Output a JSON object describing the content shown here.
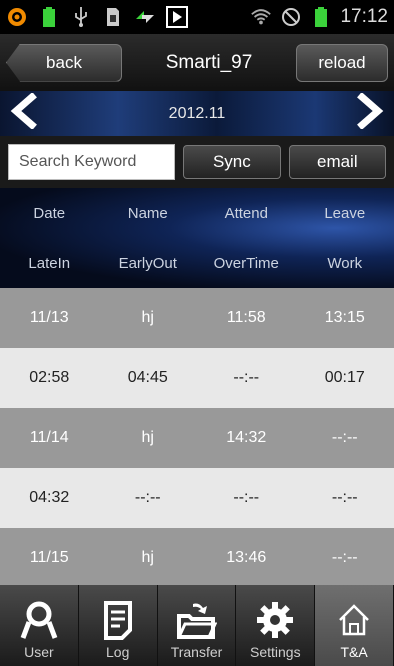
{
  "status_bar": {
    "time": "17:12",
    "icons": [
      "app-icon",
      "battery-100-icon",
      "usb-icon",
      "sim-icon",
      "transfer-icon",
      "play-store-icon",
      "wifi-icon",
      "do-not-disturb-icon",
      "battery-icon"
    ]
  },
  "title_bar": {
    "back_label": "back",
    "title": "Smarti_97",
    "reload_label": "reload"
  },
  "month_bar": {
    "prev_icon": "chevron-left-icon",
    "month": "2012.11",
    "next_icon": "chevron-right-icon"
  },
  "actions": {
    "search_placeholder": "Search Keyword",
    "sync_label": "Sync",
    "email_label": "email"
  },
  "columns": {
    "row1": [
      "Date",
      "Name",
      "Attend",
      "Leave"
    ],
    "row2": [
      "LateIn",
      "EarlyOut",
      "OverTime",
      "Work"
    ]
  },
  "records": [
    {
      "r1": [
        "11/13",
        "hj",
        "11:58",
        "13:15"
      ],
      "r2": [
        "02:58",
        "04:45",
        "--:--",
        "00:17"
      ]
    },
    {
      "r1": [
        "11/14",
        "hj",
        "14:32",
        "--:--"
      ],
      "r2": [
        "04:32",
        "--:--",
        "--:--",
        "--:--"
      ]
    },
    {
      "r1": [
        "11/15",
        "hj",
        "13:46",
        "--:--"
      ]
    }
  ],
  "tabs": [
    {
      "label": "User",
      "icon": "user-icon"
    },
    {
      "label": "Log",
      "icon": "log-icon"
    },
    {
      "label": "Transfer",
      "icon": "transfer-folder-icon"
    },
    {
      "label": "Settings",
      "icon": "gear-icon"
    },
    {
      "label": "T&A",
      "icon": "home-icon"
    }
  ],
  "active_tab": "T&A"
}
